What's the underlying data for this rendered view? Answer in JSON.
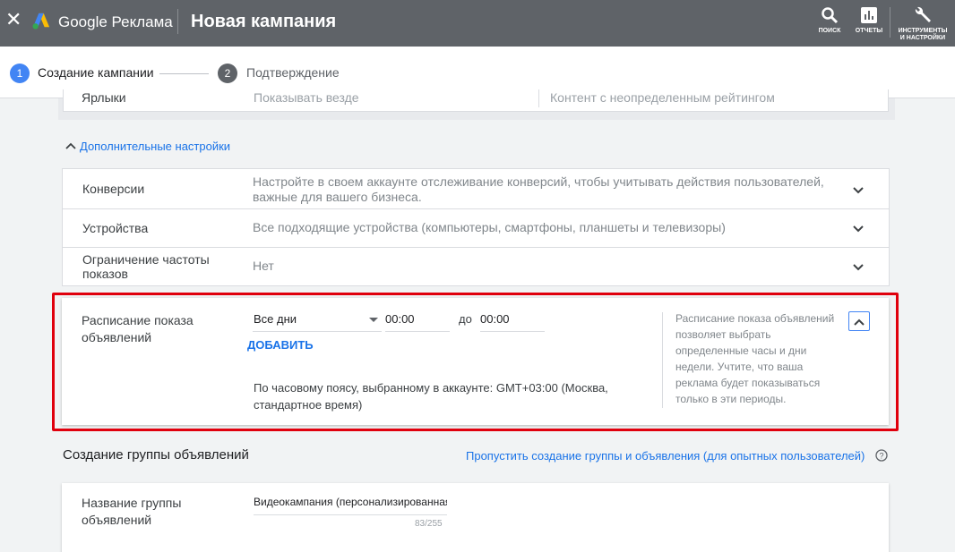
{
  "header": {
    "close_icon": "close-icon",
    "brand": "Google Реклама",
    "title": "Новая кампания",
    "tools": [
      {
        "label": "ПОИСК",
        "icon": "search-icon"
      },
      {
        "label": "ОТЧЕТЫ",
        "icon": "reports-icon"
      },
      {
        "label_line1": "ИНСТРУМЕНТЫ",
        "label_line2": "И НАСТРОЙКИ",
        "icon": "wrench-icon"
      }
    ]
  },
  "stepper": {
    "steps": [
      {
        "number": "1",
        "label": "Создание кампании"
      },
      {
        "number": "2",
        "label": "Подтверждение"
      }
    ]
  },
  "labels_row": {
    "label": "Ярлыки",
    "value1": "Показывать везде",
    "value2": "Контент с неопределенным рейтингом"
  },
  "advanced": {
    "label": "Дополнительные настройки"
  },
  "settings": [
    {
      "label": "Конверсии",
      "value": "Настройте в своем аккаунте отслеживание конверсий, чтобы учитывать действия пользователей, важные для вашего бизнеса."
    },
    {
      "label": "Устройства",
      "value": "Все подходящие устройства (компьютеры, смартфоны, планшеты и телевизоры)"
    },
    {
      "label": "Ограничение частоты показов",
      "value": "Нет"
    }
  ],
  "schedule": {
    "label": "Расписание показа объявлений",
    "days": "Все дни",
    "from": "00:00",
    "to_label": "до",
    "to": "00:00",
    "add": "ДОБАВИТЬ",
    "timezone": "По часовому поясу, выбранному в аккаунте: GMT+03:00 (Москва, стандартное время)",
    "help": "Расписание показа объявлений позволяет выбрать определенные часы и дни недели. Учтите, что ваша реклама будет показываться только в эти периоды."
  },
  "ad_group": {
    "title": "Создание группы объявлений",
    "skip": "Пропустить создание группы и объявления (для опытных пользователей)",
    "name_label": "Название группы объявлений",
    "name_value": "Видеокампания (персонализированная",
    "counter": "83/255"
  },
  "colors": {
    "topbar": "#5f6368",
    "accent": "#1a73e8",
    "highlight": "#e0000d",
    "step_active": "#4285f4"
  }
}
